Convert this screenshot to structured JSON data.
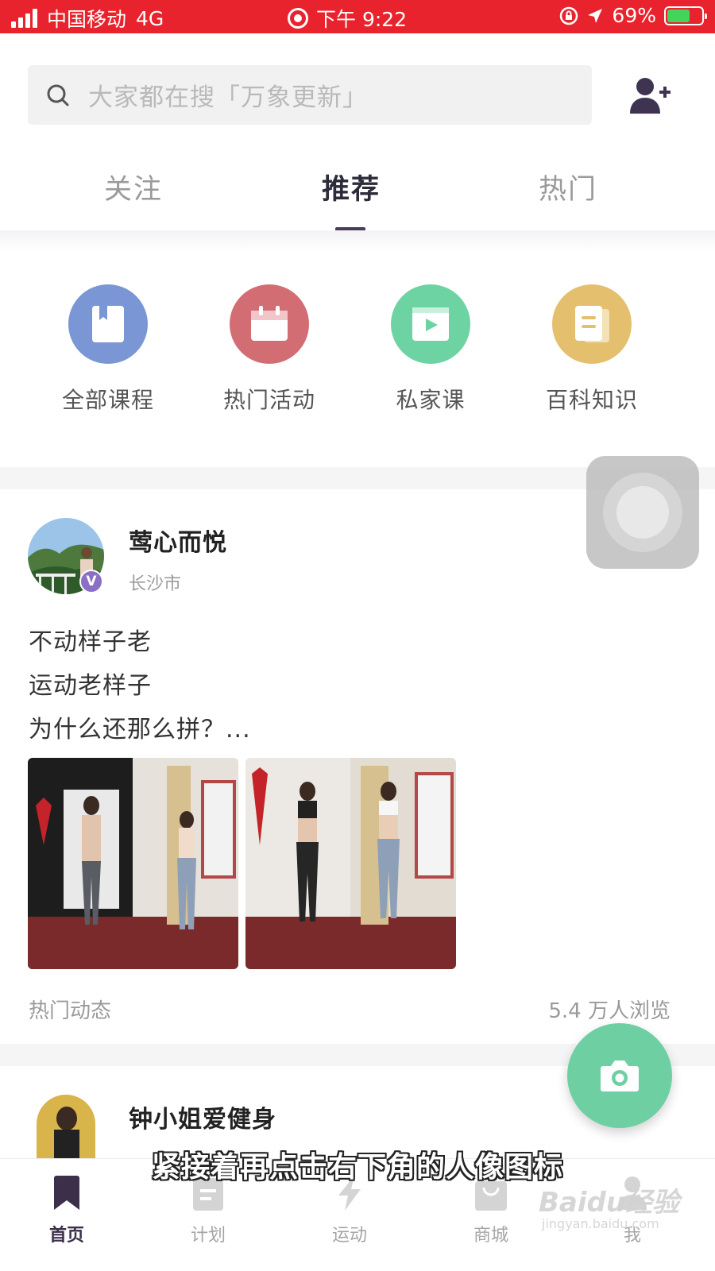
{
  "status_bar": {
    "carrier": "中国移动",
    "network": "4G",
    "time": "下午 9:22",
    "battery": "69%",
    "battery_level": 0.69
  },
  "search": {
    "placeholder": "大家都在搜「万象更新」"
  },
  "tabs": [
    {
      "label": "关注",
      "active": false
    },
    {
      "label": "推荐",
      "active": true
    },
    {
      "label": "热门",
      "active": false
    }
  ],
  "quick_actions": [
    {
      "label": "全部课程",
      "color": "#7b96d4",
      "icon": "book-icon"
    },
    {
      "label": "热门活动",
      "color": "#d36d74",
      "icon": "calendar-icon"
    },
    {
      "label": "私家课",
      "color": "#6dd3a3",
      "icon": "video-icon"
    },
    {
      "label": "百科知识",
      "color": "#e4c06e",
      "icon": "document-icon"
    }
  ],
  "post1": {
    "username": "莺心而悦",
    "location": "长沙市",
    "badge": "V",
    "lines": [
      "不动样子老",
      "运动老样子",
      "为什么还那么拼？..."
    ],
    "tag": "热门动态",
    "views": "5.4 万人浏览"
  },
  "post2": {
    "username": "钟小姐爱健身"
  },
  "bottom_nav": [
    {
      "label": "首页",
      "active": true
    },
    {
      "label": "计划",
      "active": false
    },
    {
      "label": "运动",
      "active": false
    },
    {
      "label": "商城",
      "active": false
    },
    {
      "label": "我",
      "active": false
    }
  ],
  "subtitle": "紧接着再点击右下角的人像图标",
  "watermark": {
    "brand": "Baidu经验",
    "url": "jingyan.baidu.com"
  }
}
